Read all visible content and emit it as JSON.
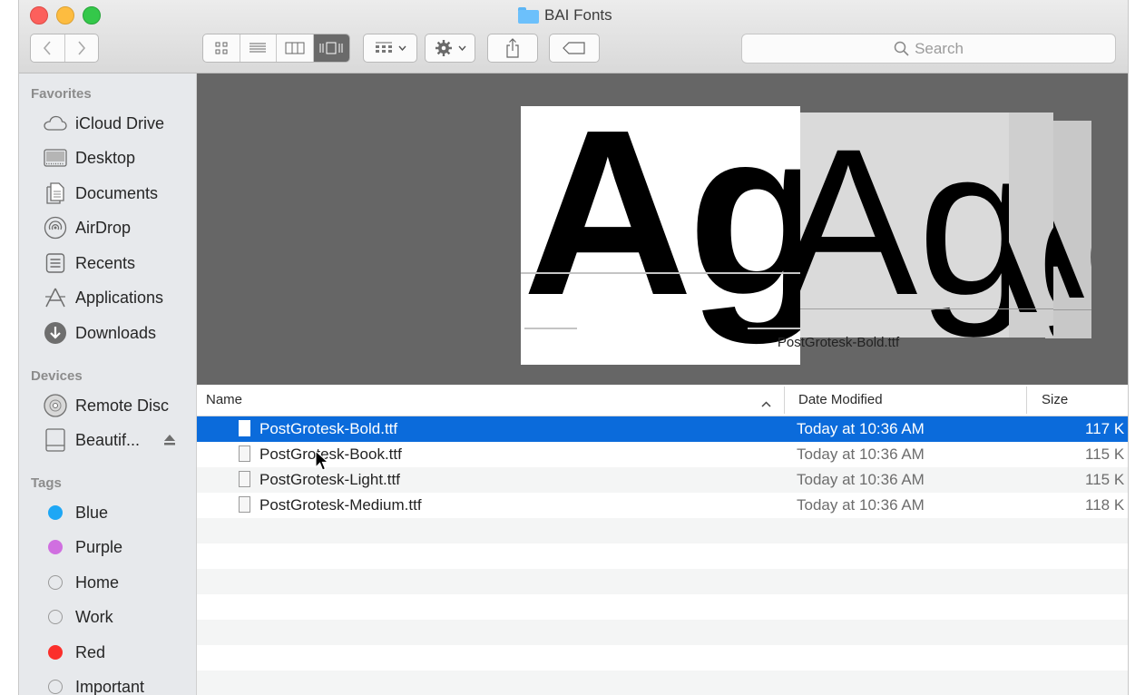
{
  "window": {
    "title": "BAI Fonts"
  },
  "toolbar": {
    "back_icon": "chevron-left-icon",
    "forward_icon": "chevron-right-icon",
    "views": [
      "icon-view",
      "list-view",
      "column-view",
      "cover-flow-view"
    ],
    "active_view": "cover-flow-view",
    "search_placeholder": "Search"
  },
  "sidebar": {
    "favorites_label": "Favorites",
    "favorites": [
      {
        "label": "iCloud Drive",
        "icon": "cloud-icon"
      },
      {
        "label": "Desktop",
        "icon": "desktop-icon"
      },
      {
        "label": "Documents",
        "icon": "documents-icon"
      },
      {
        "label": "AirDrop",
        "icon": "airdrop-icon"
      },
      {
        "label": "Recents",
        "icon": "recents-icon"
      },
      {
        "label": "Applications",
        "icon": "applications-icon"
      },
      {
        "label": "Downloads",
        "icon": "downloads-icon"
      }
    ],
    "devices_label": "Devices",
    "devices": [
      {
        "label": "Remote Disc",
        "icon": "disc-icon"
      },
      {
        "label": "Beautif...",
        "icon": "drive-icon"
      }
    ],
    "tags_label": "Tags",
    "tags": [
      {
        "label": "Blue",
        "color": "#1ea7f5"
      },
      {
        "label": "Purple",
        "color": "#d06fe0"
      },
      {
        "label": "Home",
        "color": ""
      },
      {
        "label": "Work",
        "color": ""
      },
      {
        "label": "Red",
        "color": "#fb2f2b"
      },
      {
        "label": "Important",
        "color": ""
      }
    ]
  },
  "preview": {
    "glyph_text": "Ag",
    "caption": "PostGrotesk-Bold.ttf"
  },
  "list": {
    "columns": {
      "name": "Name",
      "date": "Date Modified",
      "size": "Size"
    },
    "rows": [
      {
        "name": "PostGrotesk-Bold.ttf",
        "date": "Today at 10:36 AM",
        "size": "117 K",
        "selected": true
      },
      {
        "name": "PostGrotesk-Book.ttf",
        "date": "Today at 10:36 AM",
        "size": "115 K",
        "selected": false
      },
      {
        "name": "PostGrotesk-Light.ttf",
        "date": "Today at 10:36 AM",
        "size": "115 K",
        "selected": false
      },
      {
        "name": "PostGrotesk-Medium.ttf",
        "date": "Today at 10:36 AM",
        "size": "118 K",
        "selected": false
      }
    ]
  },
  "colors": {
    "selection": "#0b6bdb",
    "sidebar": "#e7e9ec",
    "preview_bg": "#666666"
  }
}
